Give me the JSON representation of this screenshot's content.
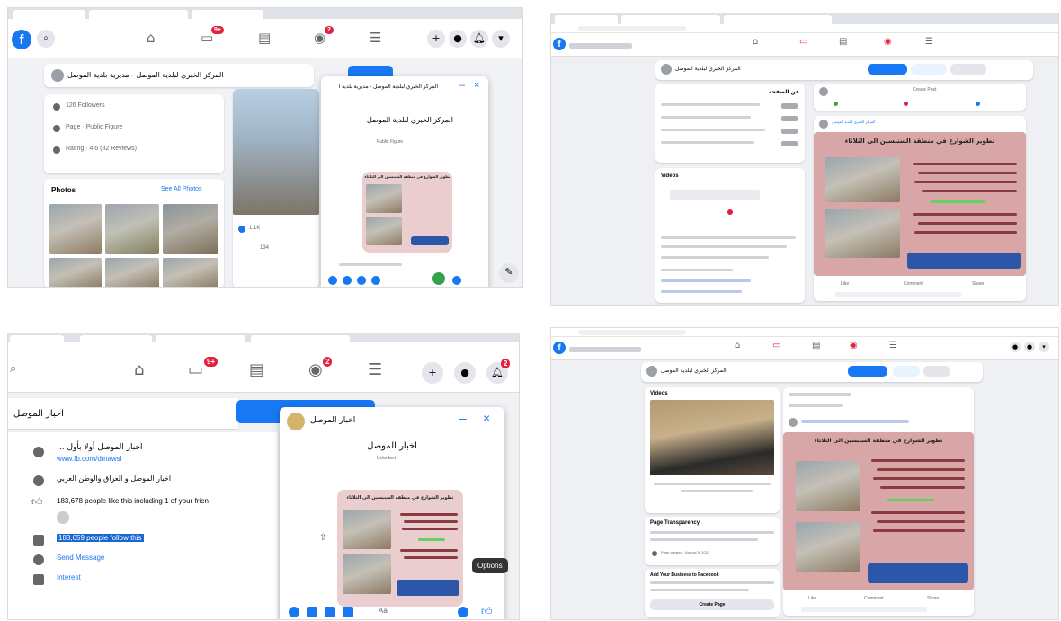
{
  "panel1": {
    "page_name": "المركز الخبري لبلدية الموصل - مديرية بلدية الموصل",
    "about_items": [
      "126 Followers",
      "Page · Public Figure",
      "Rating · 4.6 (82 Reviews)"
    ],
    "photos_title": "Photos",
    "see_all_photos": "See All Photos",
    "chat_title": "المركز الخبري لبلدية الموصل",
    "chat_header_name": "المركز الخبري لبلدية الموصل - مديرية بلدية الموصل",
    "chat_subtitle": "Public Figure",
    "post_title": "تطوير الشوارع في منطقة السنبسين الى الثلاثاء",
    "like_count": "134",
    "reactions": "1.1K",
    "badges": [
      "9+",
      "2"
    ]
  },
  "panel2": {
    "page_name": "المركز الخبري لبلدية الموصل",
    "create_post": "Create Post",
    "post_author": "المركز الخبري لبلدية الموصل",
    "post_title": "تطوير الشوارع في منطقة السنبسين الى الثلاثاء",
    "sidebar_heading": "عن الصفحة",
    "videos_heading": "Videos",
    "actions": [
      "Like",
      "Comment",
      "Share"
    ]
  },
  "panel3": {
    "page_name": "اخبار الموصل",
    "chat_name": "اخبار الموصل",
    "chat_subtitle": "Unlocked",
    "about_line1": "اخبار الموصل أولا بأول ...",
    "about_link": "www.fb.com/dmawsl",
    "about_line2": "اخبار الموصل و العراق والوطن العربي",
    "likes_text": "183,678 people like this including 1 of your frien",
    "follow_text": "183,659 people follow this",
    "send_message": "Send Message",
    "interest": "Interest",
    "post_title": "تطوير الشوارع في منطقة السنبسين الى الثلاثاء",
    "tooltip": "Options",
    "badges": [
      "9+",
      "2",
      "2"
    ],
    "input_placeholder": "Aa"
  },
  "panel4": {
    "page_name": "المركز الخبري لبلدية الموصل",
    "videos_heading": "Videos",
    "transparency_heading": "Page Transparency",
    "transparency_item": "Page created · August 5, 2021",
    "add_business": "Add Your Business to Facebook",
    "create_page": "Create Page",
    "post_title": "تطوير الشوارع في منطقة السنبسين الى الثلاثاء",
    "actions": [
      "Like",
      "Comment",
      "Share"
    ]
  },
  "colors": {
    "facebook_blue": "#1877f2",
    "notification_red": "#e41e3f",
    "post_pink": "#d9a6a8"
  }
}
